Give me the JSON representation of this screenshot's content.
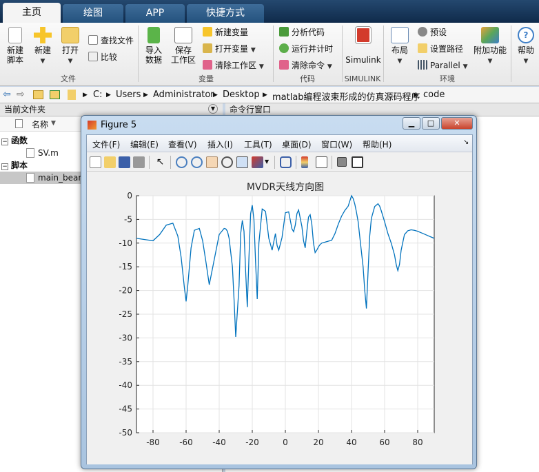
{
  "tabs": [
    "主页",
    "绘图",
    "APP",
    "快捷方式"
  ],
  "ribbon": {
    "new_script": "新建\n脚本",
    "new": "新建",
    "open": "打开",
    "find_files": "查找文件",
    "compare": "比较",
    "import_data": "导入\n数据",
    "save_workspace": "保存\n工作区",
    "new_variable": "新建变量",
    "open_variable": "打开变量",
    "clear_workspace": "清除工作区",
    "analyze_code": "分析代码",
    "run_and_time": "运行并计时",
    "clear_commands": "清除命令",
    "simulink": "Simulink",
    "layout": "布局",
    "preferences": "预设",
    "set_path": "设置路径",
    "parallel": "Parallel",
    "addons": "附加功能",
    "help": "帮助",
    "groups": {
      "file": "文件",
      "variable": "变量",
      "code": "代码",
      "simulink": "SIMULINK",
      "environment": "环境"
    }
  },
  "address": {
    "crumbs": [
      "C:",
      "Users",
      "Administrator",
      "Desktop",
      "matlab编程波束形成的仿真源码程序",
      "code"
    ]
  },
  "current_folder": {
    "title": "当前文件夹",
    "name_column": "名称",
    "sections": [
      {
        "label": "函数",
        "files": [
          "SV.m"
        ]
      },
      {
        "label": "脚本",
        "files": [
          "main_bean"
        ]
      }
    ]
  },
  "command_window": {
    "title": "命令行窗口"
  },
  "figure": {
    "title": "Figure 5",
    "menu": [
      "文件(F)",
      "编辑(E)",
      "查看(V)",
      "插入(I)",
      "工具(T)",
      "桌面(D)",
      "窗口(W)",
      "帮助(H)"
    ],
    "toolbar_icons": [
      "new-figure-icon",
      "open-file-icon",
      "save-icon",
      "print-icon",
      "pointer-icon",
      "zoom-in-icon",
      "zoom-out-icon",
      "pan-hand-icon",
      "rotate-3d-icon",
      "data-cursor-icon",
      "brush-icon",
      "link-plot-icon",
      "colorbar-icon",
      "legend-icon",
      "hide-plot-tools-icon",
      "show-plot-tools-icon"
    ]
  },
  "chart_data": {
    "type": "line",
    "title": "MVDR天线方向图",
    "xlabel": "",
    "ylabel": "",
    "xlim": [
      -90,
      90
    ],
    "ylim": [
      -50,
      0
    ],
    "xticks": [
      -80,
      -60,
      -40,
      -20,
      0,
      20,
      40,
      60,
      80
    ],
    "yticks": [
      0,
      -5,
      -10,
      -15,
      -20,
      -25,
      -30,
      -35,
      -40,
      -45,
      -50
    ],
    "grid": true,
    "line_color": "#0072bd",
    "series": [
      {
        "values_x": [
          -90,
          -84,
          -80,
          -76,
          -72,
          -68,
          -65,
          -63,
          -61,
          -60,
          -59,
          -57,
          -55,
          -52,
          -50,
          -48,
          -46,
          -43,
          -40,
          -37,
          -36,
          -35,
          -34,
          -32,
          -31,
          -30,
          -28,
          -27,
          -26,
          -25,
          -24,
          -23,
          -22,
          -21,
          -20,
          -19,
          -18,
          -17,
          -16,
          -14,
          -12,
          -10,
          -8,
          -6,
          -5,
          -4,
          -2,
          0,
          2,
          4,
          5,
          6,
          7,
          8,
          10,
          11,
          12,
          13,
          14,
          15,
          16,
          17,
          18,
          19,
          20,
          21,
          22,
          24,
          26,
          28,
          30,
          32,
          34,
          36,
          38,
          40,
          41,
          42,
          43,
          44,
          45,
          47,
          48,
          49,
          50,
          51,
          52,
          54,
          56,
          57,
          58,
          60,
          62,
          64,
          66,
          67,
          68,
          69,
          70,
          72,
          74,
          76,
          78,
          80,
          82,
          84,
          86,
          88,
          90
        ],
        "values_y": [
          -9,
          -9.3,
          -9.5,
          -8.2,
          -6.2,
          -5.8,
          -8.5,
          -13,
          -19.5,
          -22.3,
          -19,
          -11,
          -7.3,
          -6.9,
          -9.5,
          -14,
          -18.8,
          -13.5,
          -8.2,
          -6.9,
          -7,
          -7.5,
          -9,
          -15,
          -22,
          -29.8,
          -19,
          -8,
          -5.2,
          -7.5,
          -16,
          -23.5,
          -13,
          -3.8,
          -2,
          -5,
          -14,
          -21.8,
          -10,
          -2.8,
          -3.3,
          -9,
          -11.5,
          -8,
          -10.5,
          -11.5,
          -8.8,
          -3.6,
          -3.4,
          -7,
          -7.6,
          -6.2,
          -3.8,
          -3,
          -6.5,
          -9.5,
          -11,
          -7.5,
          -4.5,
          -4,
          -6,
          -10,
          -12,
          -11.5,
          -10.8,
          -10.3,
          -10,
          -9.8,
          -9.6,
          -9.4,
          -8,
          -6,
          -4.3,
          -3.1,
          -2.2,
          0,
          -0.6,
          -1.8,
          -3.5,
          -5.5,
          -8.7,
          -15,
          -20,
          -23.8,
          -16,
          -8.5,
          -4.8,
          -2.3,
          -1.7,
          -2.2,
          -3.2,
          -5.5,
          -8,
          -10,
          -12.5,
          -14.5,
          -15.8,
          -14.5,
          -11.5,
          -8.2,
          -7.4,
          -7.2,
          -7.3,
          -7.5,
          -7.8,
          -8.1,
          -8.4,
          -8.7,
          -9
        ]
      }
    ]
  },
  "colors": {
    "accent": "#0072bd",
    "tabbar": "#1a3a5e",
    "window_frame": "#b9d1ea"
  }
}
